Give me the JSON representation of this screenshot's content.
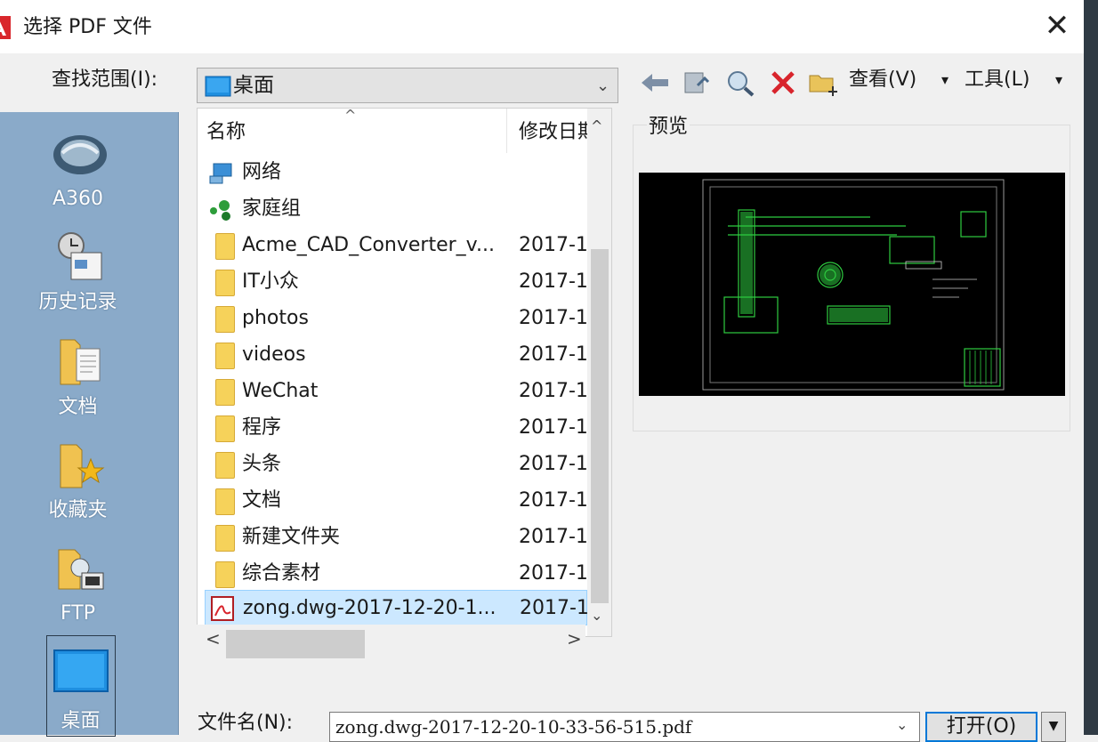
{
  "dialog": {
    "title": "选择 PDF 文件",
    "close_glyph": "✕"
  },
  "look_in": {
    "label": "查找范围(I):",
    "value": "桌面",
    "dropdown_glyph": "⌄"
  },
  "toolbar": {
    "back_icon": "back-arrow-icon",
    "up_icon": "up-folder-icon",
    "search_icon": "search-web-icon",
    "delete_icon": "delete-icon",
    "new_folder_icon": "new-folder-icon",
    "view_label": "查看(V)",
    "view_dropdown": "▾",
    "tools_label": "工具(L)",
    "tools_dropdown": "▾"
  },
  "places": [
    {
      "label": "A360",
      "icon": "a360-icon"
    },
    {
      "label": "历史记录",
      "icon": "history-icon"
    },
    {
      "label": "文档",
      "icon": "documents-icon"
    },
    {
      "label": "收藏夹",
      "icon": "favorites-icon"
    },
    {
      "label": "FTP",
      "icon": "ftp-icon"
    },
    {
      "label": "桌面",
      "icon": "desktop-icon",
      "selected": true
    }
  ],
  "file_list": {
    "columns": [
      "名称",
      "修改日期"
    ],
    "sort_glyph": "^",
    "rows": [
      {
        "name": "网络",
        "date": "",
        "icon": "network-icon"
      },
      {
        "name": "家庭组",
        "date": "",
        "icon": "homegroup-icon"
      },
      {
        "name": "Acme_CAD_Converter_v...",
        "date": "2017-1",
        "icon": "folder-icon"
      },
      {
        "name": "IT小众",
        "date": "2017-1",
        "icon": "folder-icon"
      },
      {
        "name": "photos",
        "date": "2017-1",
        "icon": "folder-icon"
      },
      {
        "name": "videos",
        "date": "2017-1",
        "icon": "folder-icon"
      },
      {
        "name": "WeChat",
        "date": "2017-1",
        "icon": "folder-icon"
      },
      {
        "name": "程序",
        "date": "2017-1",
        "icon": "folder-icon"
      },
      {
        "name": "头条",
        "date": "2017-1",
        "icon": "folder-icon"
      },
      {
        "name": "文档",
        "date": "2017-1",
        "icon": "folder-icon"
      },
      {
        "name": "新建文件夹",
        "date": "2017-1",
        "icon": "folder-icon"
      },
      {
        "name": "综合素材",
        "date": "2017-1",
        "icon": "folder-icon"
      },
      {
        "name": "zong.dwg-2017-12-20-1...",
        "date": "2017-1",
        "icon": "pdf-file-icon",
        "selected": true
      }
    ],
    "scroll_up": "^",
    "scroll_down": "⌄",
    "scroll_left": "<",
    "scroll_right": ">"
  },
  "preview": {
    "label": "预览"
  },
  "file_name": {
    "label": "文件名(N):",
    "value": "zong.dwg-2017-12-20-10-33-56-515.pdf",
    "dropdown_glyph": "⌄"
  },
  "buttons": {
    "open_label": "打开(O)",
    "open_dropdown": "▼"
  },
  "colors": {
    "places_bg": "#8aaac9",
    "selection": "#cce8ff",
    "folder": "#f6d25a",
    "accent": "#0078d7"
  }
}
